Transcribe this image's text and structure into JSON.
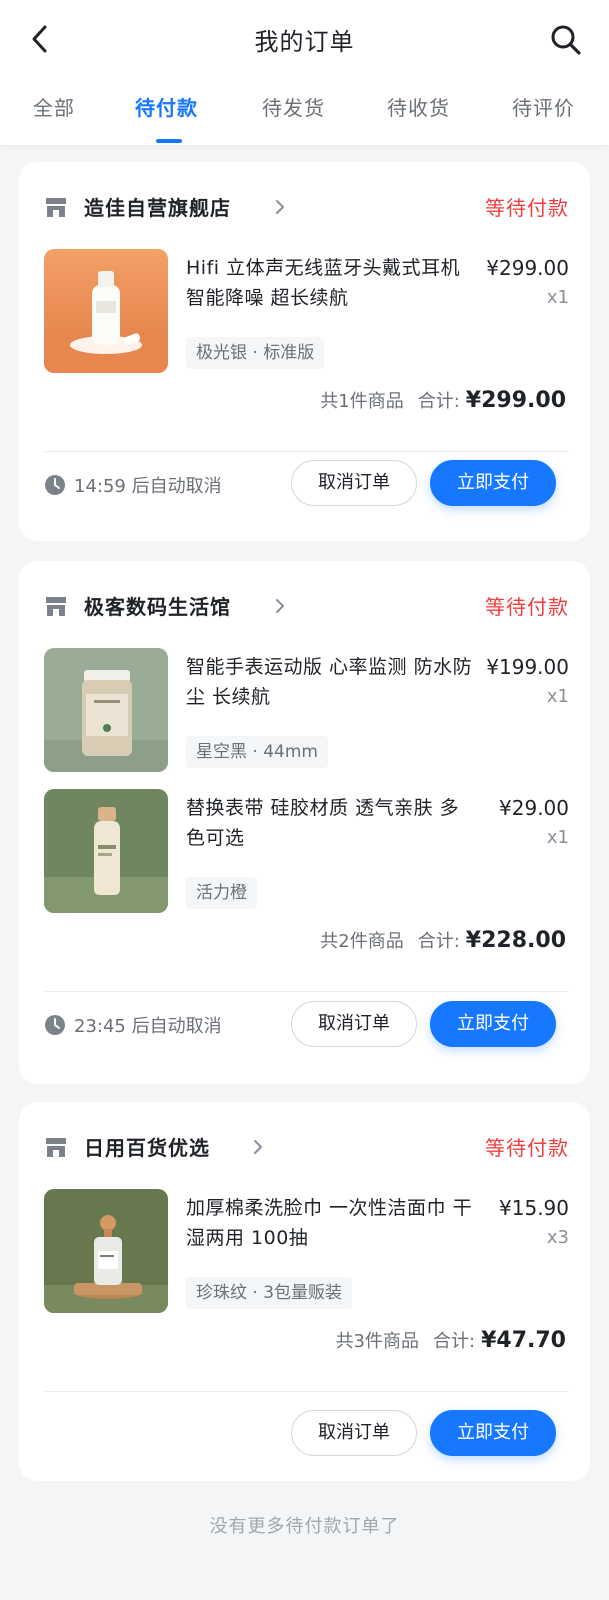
{
  "header": {
    "title": "我的订单",
    "back_icon": "back-arrow-icon",
    "search_icon": "search-icon"
  },
  "tabs": [
    {
      "label": "全部",
      "active": false
    },
    {
      "label": "待付款",
      "active": true
    },
    {
      "label": "待发货",
      "active": false
    },
    {
      "label": "待收货",
      "active": false
    },
    {
      "label": "待评价",
      "active": false
    }
  ],
  "colors": {
    "accent": "#1677ff",
    "status": "#f03d3d",
    "background": "#f4f5f7"
  },
  "orders": [
    {
      "store": "造佳自营旗舰店",
      "status": "等待付款",
      "items": [
        {
          "name": "Hifi 立体声无线蓝牙头戴式耳机 智能降噪 超长续航",
          "price": "¥299.00",
          "qty": "x1",
          "spec": "极光银 · 标准版"
        }
      ],
      "count_text": "共1件商品",
      "total_label": "合计:",
      "total": "¥299.00",
      "timer": "14:59 后自动取消",
      "cancel_label": "取消订单",
      "pay_label": "立即支付"
    },
    {
      "store": "极客数码生活馆",
      "status": "等待付款",
      "items": [
        {
          "name": "智能手表运动版 心率监测 防水防尘 长续航",
          "price": "¥199.00",
          "qty": "x1",
          "spec": "星空黑 · 44mm"
        },
        {
          "name": "替换表带 硅胶材质 透气亲肤 多色可选",
          "price": "¥29.00",
          "qty": "x1",
          "spec": "活力橙"
        }
      ],
      "count_text": "共2件商品",
      "total_label": "合计:",
      "total": "¥228.00",
      "timer": "23:45 后自动取消",
      "cancel_label": "取消订单",
      "pay_label": "立即支付"
    },
    {
      "store": "日用百货优选",
      "status": "等待付款",
      "items": [
        {
          "name": "加厚棉柔洗脸巾 一次性洁面巾 干湿两用 100抽",
          "price": "¥15.90",
          "qty": "x3",
          "spec": "珍珠纹 · 3包量贩装"
        }
      ],
      "count_text": "共3件商品",
      "total_label": "合计:",
      "total": "¥47.70",
      "cancel_label": "取消订单",
      "pay_label": "立即支付"
    }
  ],
  "footer": {
    "text": "没有更多待付款订单了"
  }
}
